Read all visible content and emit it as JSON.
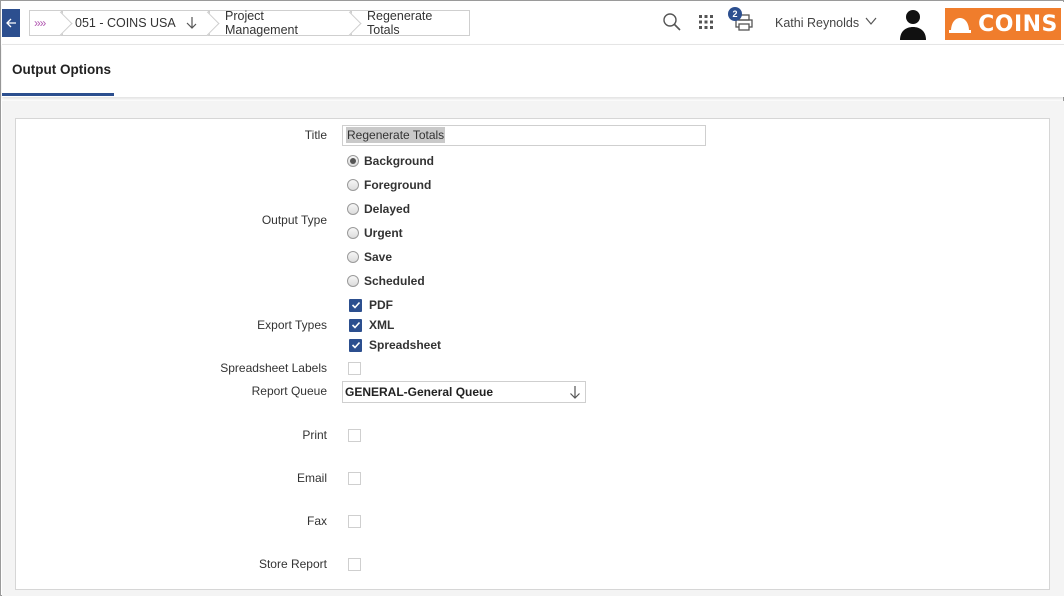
{
  "breadcrumb": {
    "expand_label": "»»",
    "company": "051 - COINS USA",
    "module": "Project Management",
    "page": "Regenerate Totals"
  },
  "header": {
    "print_badge_count": "2",
    "user_name": "Kathi Reynolds",
    "logo_text": "COINS",
    "brand_color": "#f07d2c",
    "accent_color": "#2c4f8f"
  },
  "tabs": [
    {
      "label": "Output Options",
      "active": true
    }
  ],
  "form": {
    "title_label": "Title",
    "title_value": "Regenerate Totals",
    "output_type_label": "Output Type",
    "output_types": [
      {
        "label": "Background",
        "checked": true
      },
      {
        "label": "Foreground",
        "checked": false
      },
      {
        "label": "Delayed",
        "checked": false
      },
      {
        "label": "Urgent",
        "checked": false
      },
      {
        "label": "Save",
        "checked": false
      },
      {
        "label": "Scheduled",
        "checked": false
      }
    ],
    "export_types_label": "Export Types",
    "export_types": [
      {
        "label": "PDF",
        "checked": true
      },
      {
        "label": "XML",
        "checked": true
      },
      {
        "label": "Spreadsheet",
        "checked": true
      }
    ],
    "spreadsheet_labels_label": "Spreadsheet Labels",
    "report_queue_label": "Report Queue",
    "report_queue_value": "GENERAL-General Queue",
    "print_label": "Print",
    "email_label": "Email",
    "fax_label": "Fax",
    "store_report_label": "Store Report"
  }
}
